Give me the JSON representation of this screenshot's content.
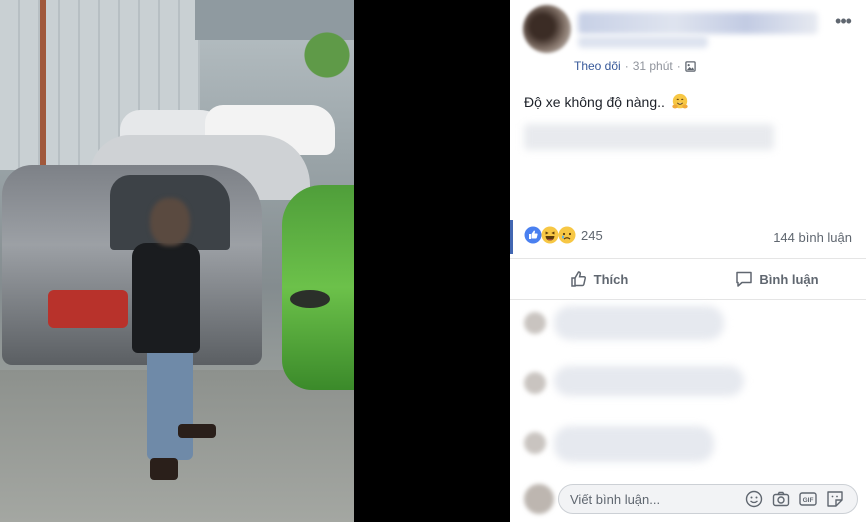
{
  "post": {
    "follow_label": "Theo dõi",
    "separator": "·",
    "time": "31 phút",
    "text": "Độ xe không độ nàng..",
    "more_label": "•••"
  },
  "reactions": {
    "count": "245",
    "icons": [
      "like-icon",
      "haha-icon",
      "sad-icon"
    ],
    "comments_count": "144 bình luận"
  },
  "actions": {
    "like_label": "Thích",
    "comment_label": "Bình luận"
  },
  "comment_box": {
    "placeholder": "Viết bình luận...",
    "icons": [
      "emoji-icon",
      "camera-icon",
      "gif-icon",
      "sticker-icon"
    ]
  },
  "colors": {
    "link": "#365899",
    "muted": "#606770",
    "text": "#1d2129",
    "accent": "#4267b2"
  }
}
